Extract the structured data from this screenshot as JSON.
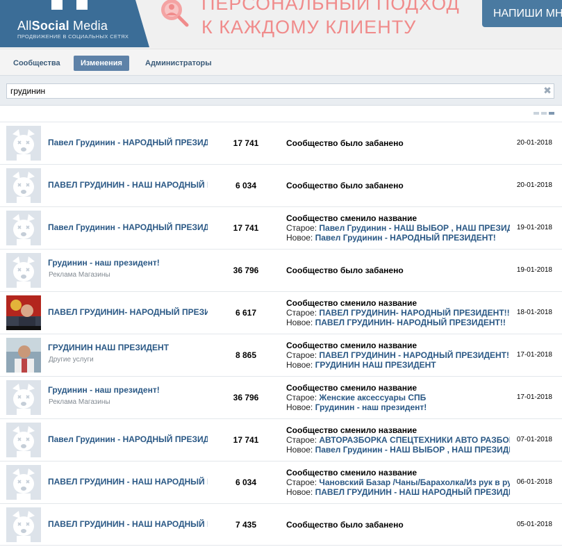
{
  "banner": {
    "logo_title_light": "All",
    "logo_title_bold": "Social",
    "logo_title_rest": " Media",
    "logo_subtitle": "ПРОДВИЖЕНИЕ В СОЦИАЛЬНЫХ СЕТЯХ",
    "promo_line1": "ПЕРСОНАЛЬНЫЙ ПОДХОД",
    "promo_line2": "К КАЖДОМУ КЛИЕНТУ",
    "cta_label": "НАПИШИ МНЕ",
    "brand_color": "#3b6d97",
    "promo_color": "#f08b8b"
  },
  "tabs": [
    {
      "label": "Сообщества",
      "active": false
    },
    {
      "label": "Изменения",
      "active": true
    },
    {
      "label": "Администраторы",
      "active": false
    }
  ],
  "search": {
    "value": "грудинин",
    "clear_icon": "close-icon"
  },
  "rows": [
    {
      "avatar": "default-avatar",
      "name": "Павел Грудинин - НАРОДНЫЙ ПРЕЗИДЕНТ!",
      "category": "",
      "members": "17 741",
      "change_title": "Сообщество было забанено",
      "old_label": "",
      "old_value": "",
      "new_label": "",
      "new_value": "",
      "date": "20-01-2018"
    },
    {
      "avatar": "default-avatar",
      "name": "ПАВЕЛ ГРУДИНИН - НАШ НАРОДНЫЙ ПРЕЗИДЕНТ",
      "category": "",
      "members": "6 034",
      "change_title": "Сообщество было забанено",
      "old_label": "",
      "old_value": "",
      "new_label": "",
      "new_value": "",
      "date": "20-01-2018"
    },
    {
      "avatar": "default-avatar",
      "name": "Павел Грудинин - НАРОДНЫЙ ПРЕЗИДЕНТ!",
      "category": "",
      "members": "17 741",
      "change_title": "Сообщество сменило название",
      "old_label": "Старое: ",
      "old_value": "Павел Грудинин - НАШ ВЫБОР , НАШ ПРЕЗИДЕНТ",
      "new_label": "Новое: ",
      "new_value": "Павел Грудинин - НАРОДНЫЙ ПРЕЗИДЕНТ!",
      "date": "19-01-2018"
    },
    {
      "avatar": "default-avatar",
      "name": "Грудинин - наш президент!",
      "category": "Реклама Магазины",
      "members": "36 796",
      "change_title": "Сообщество было забанено",
      "old_label": "",
      "old_value": "",
      "new_label": "",
      "new_value": "",
      "date": "19-01-2018"
    },
    {
      "avatar": "photo-portrait-flag",
      "name": "ПАВЕЛ ГРУДИНИН- НАРОДНЫЙ ПРЕЗИДЕНТ!!",
      "category": "",
      "members": "6 617",
      "change_title": "Сообщество сменило название",
      "old_label": "Старое: ",
      "old_value": "ПАВЕЛ ГРУДИНИН- НАРОДНЫЙ ПРЕЗИДЕНТ!!",
      "new_label": "Новое: ",
      "new_value": "ПАВЕЛ ГРУДИНИН- НАРОДНЫЙ ПРЕЗИДЕНТ!!",
      "date": "18-01-2018"
    },
    {
      "avatar": "photo-portrait",
      "name": "ГРУДИНИН НАШ ПРЕЗИДЕНТ",
      "category": "Другие услуги",
      "members": "8 865",
      "change_title": "Сообщество сменило название",
      "old_label": "Старое: ",
      "old_value": "ПАВЕЛ ГРУДИНИН - НАРОДНЫЙ ПРЕЗИДЕНТ!",
      "new_label": "Новое: ",
      "new_value": "ГРУДИНИН НАШ ПРЕЗИДЕНТ",
      "date": "17-01-2018"
    },
    {
      "avatar": "default-avatar",
      "name": "Грудинин - наш президент!",
      "category": "Реклама Магазины",
      "members": "36 796",
      "change_title": "Сообщество сменило название",
      "old_label": "Старое: ",
      "old_value": "Женские аксессуары СПБ",
      "new_label": "Новое: ",
      "new_value": "Грудинин - наш президент!",
      "date": "17-01-2018"
    },
    {
      "avatar": "default-avatar",
      "name": "Павел Грудинин - НАРОДНЫЙ ПРЕЗИДЕНТ!",
      "category": "",
      "members": "17 741",
      "change_title": "Сообщество сменило название",
      "old_label": "Старое: ",
      "old_value": "АВТОРАЗБОРКА СПЕЦТЕХНИКИ АВТО РАЗБОРКА",
      "new_label": "Новое: ",
      "new_value": "Павел Грудинин - НАШ ВЫБОР , НАШ ПРЕЗИДЕНТ",
      "date": "07-01-2018"
    },
    {
      "avatar": "default-avatar",
      "name": "ПАВЕЛ ГРУДИНИН - НАШ НАРОДНЫЙ ПРЕЗИДЕНТ",
      "category": "",
      "members": "6 034",
      "change_title": "Сообщество сменило название",
      "old_label": "Старое: ",
      "old_value": "Чановский Базар /Чаны/Барахолка/Из рук в руки",
      "new_label": "Новое: ",
      "new_value": "ПАВЕЛ ГРУДИНИН - НАШ НАРОДНЫЙ ПРЕЗИДЕНТ",
      "date": "06-01-2018"
    },
    {
      "avatar": "default-avatar",
      "name": "ПАВЕЛ ГРУДИНИН - НАШ НАРОДНЫЙ ПРЕЗИДЕНТ",
      "category": "",
      "members": "7 435",
      "change_title": "Сообщество было забанено",
      "old_label": "",
      "old_value": "",
      "new_label": "",
      "new_value": "",
      "date": "05-01-2018"
    }
  ]
}
